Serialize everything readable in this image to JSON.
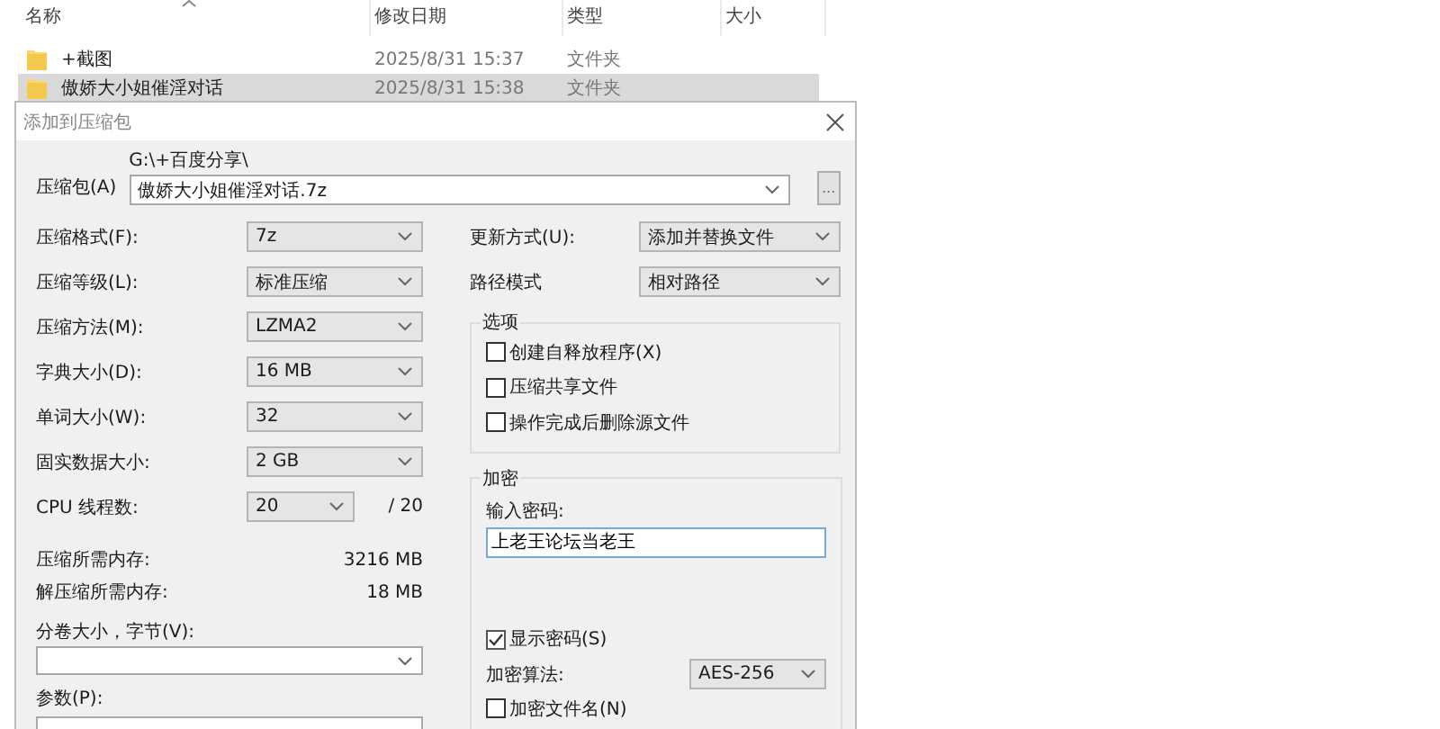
{
  "explorer": {
    "columns": [
      "名称",
      "修改日期",
      "类型",
      "大小"
    ],
    "rows": [
      {
        "name": "+截图",
        "modified": "2025/8/31 15:37",
        "type": "文件夹",
        "selected": false
      },
      {
        "name": "傲娇大小姐催淫对话",
        "modified": "2025/8/31 15:38",
        "type": "文件夹",
        "selected": true
      }
    ]
  },
  "dialog": {
    "title": "添加到压缩包",
    "archive": {
      "label": "压缩包(A)",
      "path": "G:\\+百度分享\\",
      "value": "傲娇大小姐催淫对话.7z",
      "browse": "..."
    },
    "left_rows": [
      {
        "kind": "select",
        "label": "压缩格式(F):",
        "value": "7z"
      },
      {
        "kind": "select",
        "label": "压缩等级(L):",
        "value": "标准压缩"
      },
      {
        "kind": "select",
        "label": "压缩方法(M):",
        "value": "LZMA2"
      },
      {
        "kind": "select",
        "label": "字典大小(D):",
        "value": "16 MB"
      },
      {
        "kind": "select",
        "label": "单词大小(W):",
        "value": "32"
      },
      {
        "kind": "select",
        "label": "固实数据大小:",
        "value": "2 GB"
      },
      {
        "kind": "select_max",
        "label": "CPU 线程数:",
        "value": "20",
        "max": "/ 20"
      },
      {
        "kind": "reading",
        "label": "压缩所需内存:",
        "value": "3216 MB"
      },
      {
        "kind": "reading",
        "label": "解压缩所需内存:",
        "value": "18 MB"
      }
    ],
    "volume": {
      "label": "分卷大小，字节(V):"
    },
    "params": {
      "label": "参数(P):"
    },
    "right_rows": [
      {
        "label": "更新方式(U):",
        "value": "添加并替换文件"
      },
      {
        "label": "路径模式",
        "value": "相对路径"
      }
    ],
    "options": {
      "title": "选项",
      "items": [
        {
          "label": "创建自释放程序(X)",
          "checked": false
        },
        {
          "label": "压缩共享文件",
          "checked": false
        },
        {
          "label": "操作完成后删除源文件",
          "checked": false
        }
      ]
    },
    "encryption": {
      "title": "加密",
      "password_label": "输入密码:",
      "password": "上老王论坛当老王",
      "show_password": {
        "label": "显示密码(S)",
        "checked": true
      },
      "method": {
        "label": "加密算法:",
        "value": "AES-256"
      },
      "encrypt_names": {
        "label": "加密文件名(N)",
        "checked": false
      }
    }
  }
}
